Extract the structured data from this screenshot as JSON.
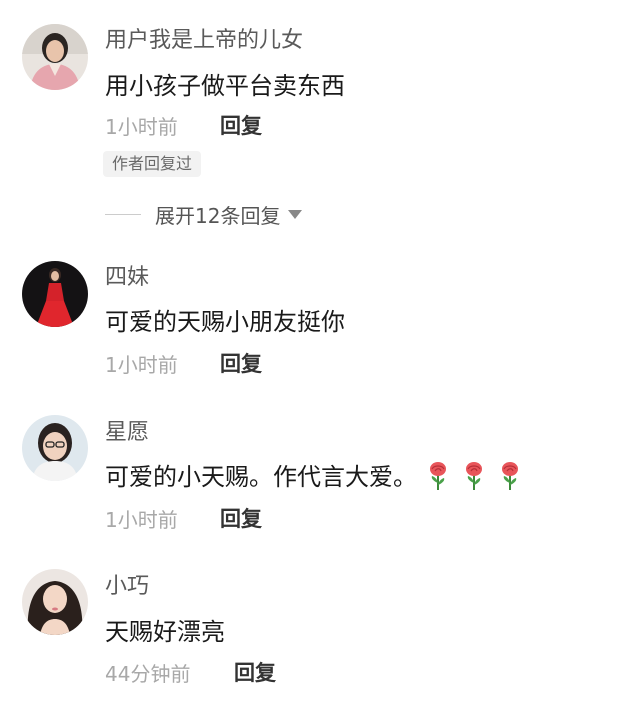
{
  "comments": [
    {
      "avatar_icon": "user-avatar-woman-pink-coat",
      "username": "用户我是上帝的儿女",
      "text": "用小孩子做平台卖东西",
      "time": "1小时前",
      "reply_label": "回复",
      "badge": "作者回复过",
      "expand_label": "展开12条回复"
    },
    {
      "avatar_icon": "user-avatar-woman-red-dress",
      "username": "四妹",
      "text": "可爱的天赐小朋友挺你",
      "time": "1小时前",
      "reply_label": "回复"
    },
    {
      "avatar_icon": "user-avatar-woman-glasses",
      "username": "星愿",
      "text": "可爱的小天赐。作代言大爱。",
      "time": "1小时前",
      "reply_label": "回复",
      "emoji": [
        "rose-emoji",
        "rose-emoji",
        "rose-emoji"
      ]
    },
    {
      "avatar_icon": "user-avatar-woman-long-hair",
      "username": "小巧",
      "text": "天赐好漂亮",
      "time": "44分钟前",
      "reply_label": "回复"
    }
  ],
  "colors": {
    "username": "#5a5a5a",
    "content": "#1a1a1a",
    "time": "#a8a8a8",
    "reply": "#333333",
    "badge_bg": "#f2f2f2"
  }
}
